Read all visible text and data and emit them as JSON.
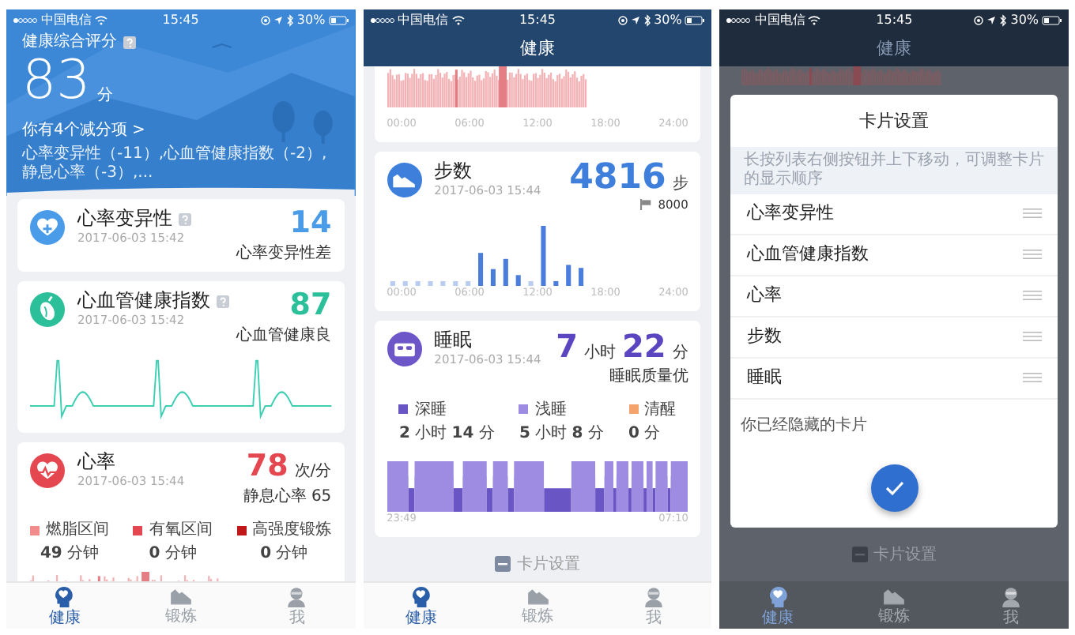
{
  "health_home": {
    "status_bar": {
      "carrier": "中国电信",
      "time": "15:45",
      "battery": "30%"
    },
    "score_label": "健康综合评分",
    "score": "83",
    "score_unit": "分",
    "deductions_link": "你有4个减分项 >",
    "deductions_detail": "心率变异性（-11）,心血管健康指数（-2）,静息心率（-3）,...",
    "cards": [
      {
        "kind": "hrv",
        "title": "心率变异性",
        "help": true,
        "time": "2017-06-03 15:42",
        "value": "14",
        "note": "心率变异性差",
        "color": "#4a9be8"
      },
      {
        "kind": "cardio",
        "title": "心血管健康指数",
        "help": true,
        "time": "2017-06-03 15:42",
        "value": "87",
        "note": "心血管健康良",
        "color": "#2bbf9a"
      },
      {
        "kind": "heart_rate",
        "title": "心率",
        "help": false,
        "time": "2017-06-03 15:44",
        "value": "78",
        "unit": "次/分",
        "note": "静息心率 65",
        "color": "#e4474f",
        "zones": [
          {
            "label": "燃脂区间",
            "value": "**49** 分钟",
            "color": "#f08c8c"
          },
          {
            "label": "有氧区间",
            "value": "**0** 分钟",
            "color": "#e4474f"
          },
          {
            "label": "高强度锻炼",
            "value": "**0** 分钟",
            "color": "#c01818"
          }
        ]
      }
    ],
    "tabs": [
      {
        "label": "健康",
        "selected": true
      },
      {
        "label": "锻炼",
        "selected": false
      },
      {
        "label": "我",
        "selected": false
      }
    ]
  },
  "health_scrolled": {
    "status_bar": {
      "carrier": "中国电信",
      "time": "15:45",
      "battery": "30%"
    },
    "nav_title": "健康",
    "heart_chart_axis": [
      "00:00",
      "06:00",
      "12:00",
      "18:00",
      "24:00"
    ],
    "steps": {
      "title": "步数",
      "time": "2017-06-03 15:44",
      "value": "4816",
      "unit": "步",
      "goal": "8000",
      "axis": [
        "00:00",
        "06:00",
        "12:00",
        "18:00",
        "24:00"
      ]
    },
    "sleep": {
      "title": "睡眠",
      "time": "2017-06-03 15:44",
      "hours": "7",
      "hours_unit": "小时",
      "minutes": "22",
      "minutes_unit": "分",
      "note": "睡眠质量优",
      "legend": [
        {
          "label": "深睡",
          "value": "**2** 小时 **14** 分",
          "color": "#6a55c4"
        },
        {
          "label": "浅睡",
          "value": "**5** 小时 **8** 分",
          "color": "#9d8ce2"
        },
        {
          "label": "清醒",
          "value": "**0** 分",
          "color": "#f5a36c"
        }
      ],
      "axis": [
        "23:49",
        "07:10"
      ]
    },
    "card_settings_button": "卡片设置",
    "tabs": [
      {
        "label": "健康",
        "selected": true
      },
      {
        "label": "锻炼",
        "selected": false
      },
      {
        "label": "我",
        "selected": false
      }
    ]
  },
  "card_settings": {
    "status_bar": {
      "carrier": "中国电信",
      "time": "15:45",
      "battery": "30%"
    },
    "nav_title": "健康",
    "dialog": {
      "title": "卡片设置",
      "hint": "长按列表右侧按钮并上下移动，可调整卡片的显示顺序",
      "items": [
        "心率变异性",
        "心血管健康指数",
        "心率",
        "步数",
        "睡眠"
      ],
      "hidden_label": "你已经隐藏的卡片"
    },
    "card_settings_button": "卡片设置",
    "tabs": [
      {
        "label": "健康",
        "selected": true
      },
      {
        "label": "锻炼",
        "selected": false
      },
      {
        "label": "我",
        "selected": false
      }
    ]
  }
}
